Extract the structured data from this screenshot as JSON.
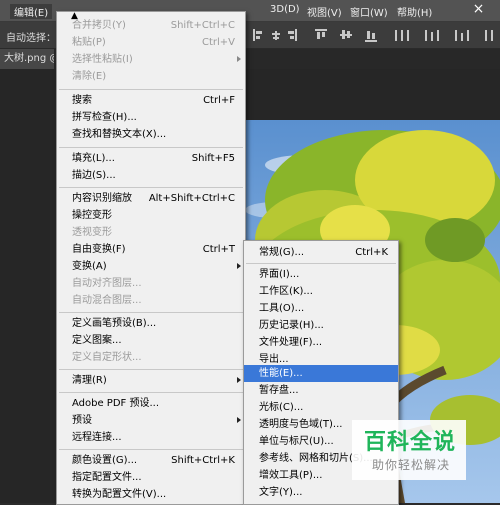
{
  "menubar": {
    "items": [
      {
        "label": "编辑(E)",
        "active": true
      },
      {
        "label": "3D(D)"
      },
      {
        "label": "视图(V)"
      },
      {
        "label": "窗口(W)"
      },
      {
        "label": "帮助(H)"
      }
    ]
  },
  "options": {
    "auto_select_label": "自动选择："
  },
  "document": {
    "tab_label": "大树.png @"
  },
  "edit_menu": {
    "top_arrow": "▲",
    "items": [
      {
        "label": "合并拷贝(Y)",
        "shortcut": "Shift+Ctrl+C",
        "disabled": true
      },
      {
        "label": "粘贴(P)",
        "shortcut": "Ctrl+V",
        "disabled": true
      },
      {
        "label": "选择性粘贴(I)",
        "disabled": true,
        "submenu": true
      },
      {
        "label": "清除(E)",
        "disabled": true
      },
      {
        "label": "搜索",
        "shortcut": "Ctrl+F"
      },
      {
        "label": "拼写检查(H)..."
      },
      {
        "label": "查找和替换文本(X)..."
      },
      {
        "label": "填充(L)...",
        "shortcut": "Shift+F5"
      },
      {
        "label": "描边(S)..."
      },
      {
        "label": "内容识别缩放",
        "shortcut": "Alt+Shift+Ctrl+C"
      },
      {
        "label": "操控变形"
      },
      {
        "label": "透视变形",
        "disabled": true
      },
      {
        "label": "自由变换(F)",
        "shortcut": "Ctrl+T"
      },
      {
        "label": "变换(A)",
        "submenu": true
      },
      {
        "label": "自动对齐图层...",
        "disabled": true
      },
      {
        "label": "自动混合图层...",
        "disabled": true
      },
      {
        "label": "定义画笔预设(B)..."
      },
      {
        "label": "定义图案..."
      },
      {
        "label": "定义自定形状...",
        "disabled": true
      },
      {
        "label": "清理(R)",
        "submenu": true
      },
      {
        "label": "Adobe PDF 预设..."
      },
      {
        "label": "预设",
        "submenu": true
      },
      {
        "label": "远程连接..."
      },
      {
        "label": "颜色设置(G)...",
        "shortcut": "Shift+Ctrl+K"
      },
      {
        "label": "指定配置文件..."
      },
      {
        "label": "转换为配置文件(V)..."
      }
    ]
  },
  "prefs_menu": {
    "items": [
      {
        "label": "常规(G)...",
        "shortcut": "Ctrl+K"
      },
      {
        "label": "界面(I)..."
      },
      {
        "label": "工作区(K)..."
      },
      {
        "label": "工具(O)..."
      },
      {
        "label": "历史记录(H)..."
      },
      {
        "label": "文件处理(F)..."
      },
      {
        "label": "导出..."
      },
      {
        "label": "性能(E)...",
        "selected": true
      },
      {
        "label": "暂存盘..."
      },
      {
        "label": "光标(C)..."
      },
      {
        "label": "透明度与色域(T)..."
      },
      {
        "label": "单位与标尺(U)..."
      },
      {
        "label": "参考线、网格和切片(S)..."
      },
      {
        "label": "增效工具(P)..."
      },
      {
        "label": "文字(Y)..."
      }
    ]
  },
  "watermark": {
    "title": "百科全说",
    "subtitle": "助你轻松解决"
  },
  "colors": {
    "menu_bg": "#f0f0f0",
    "highlight": "#3a78d8",
    "watermark_green": "#1fb55a"
  }
}
